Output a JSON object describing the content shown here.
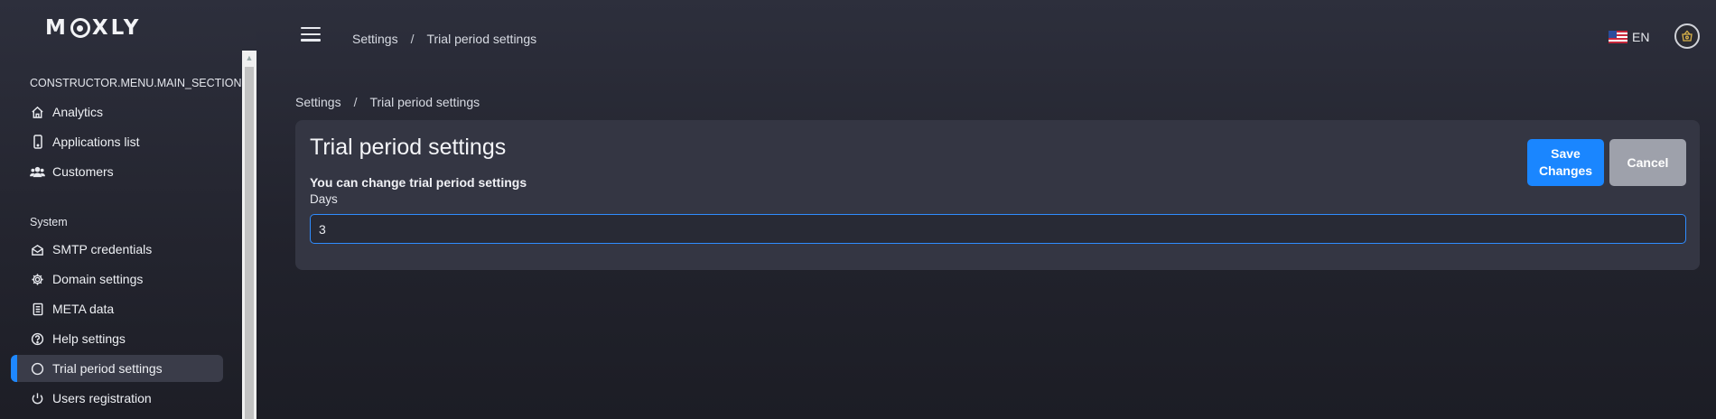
{
  "app": {
    "logo_text_left": "M",
    "logo_text_right": "XLY"
  },
  "header": {
    "breadcrumb": [
      "Settings",
      "Trial period settings"
    ],
    "separator": "/",
    "language": "EN"
  },
  "sidebar": {
    "main_section_title": "CONSTRUCTOR.MENU.MAIN_SECTION",
    "main_items": [
      {
        "label": "Analytics",
        "icon": "home-icon"
      },
      {
        "label": "Applications list",
        "icon": "mobile-icon"
      },
      {
        "label": "Customers",
        "icon": "users-icon"
      }
    ],
    "system_section_title": "System",
    "system_items": [
      {
        "label": "SMTP credentials",
        "icon": "mail-icon"
      },
      {
        "label": "Domain settings",
        "icon": "gear-icon"
      },
      {
        "label": "META data",
        "icon": "document-icon"
      },
      {
        "label": "Help settings",
        "icon": "help-icon"
      },
      {
        "label": "Trial period settings",
        "icon": "circle-icon",
        "active": true
      },
      {
        "label": "Users registration",
        "icon": "power-icon"
      }
    ]
  },
  "page": {
    "breadcrumb": [
      "Settings",
      "Trial period settings"
    ],
    "separator": "/",
    "title": "Trial period settings",
    "subtitle": "You can change trial period settings",
    "days_label": "Days",
    "days_value": "3",
    "save_label_line1": "Save",
    "save_label_line2": "Changes",
    "cancel_label": "Cancel"
  },
  "colors": {
    "accent": "#1a86ff",
    "cancel": "#9ea1ab",
    "card": "#343643",
    "active_nav": "#3a3c49"
  }
}
